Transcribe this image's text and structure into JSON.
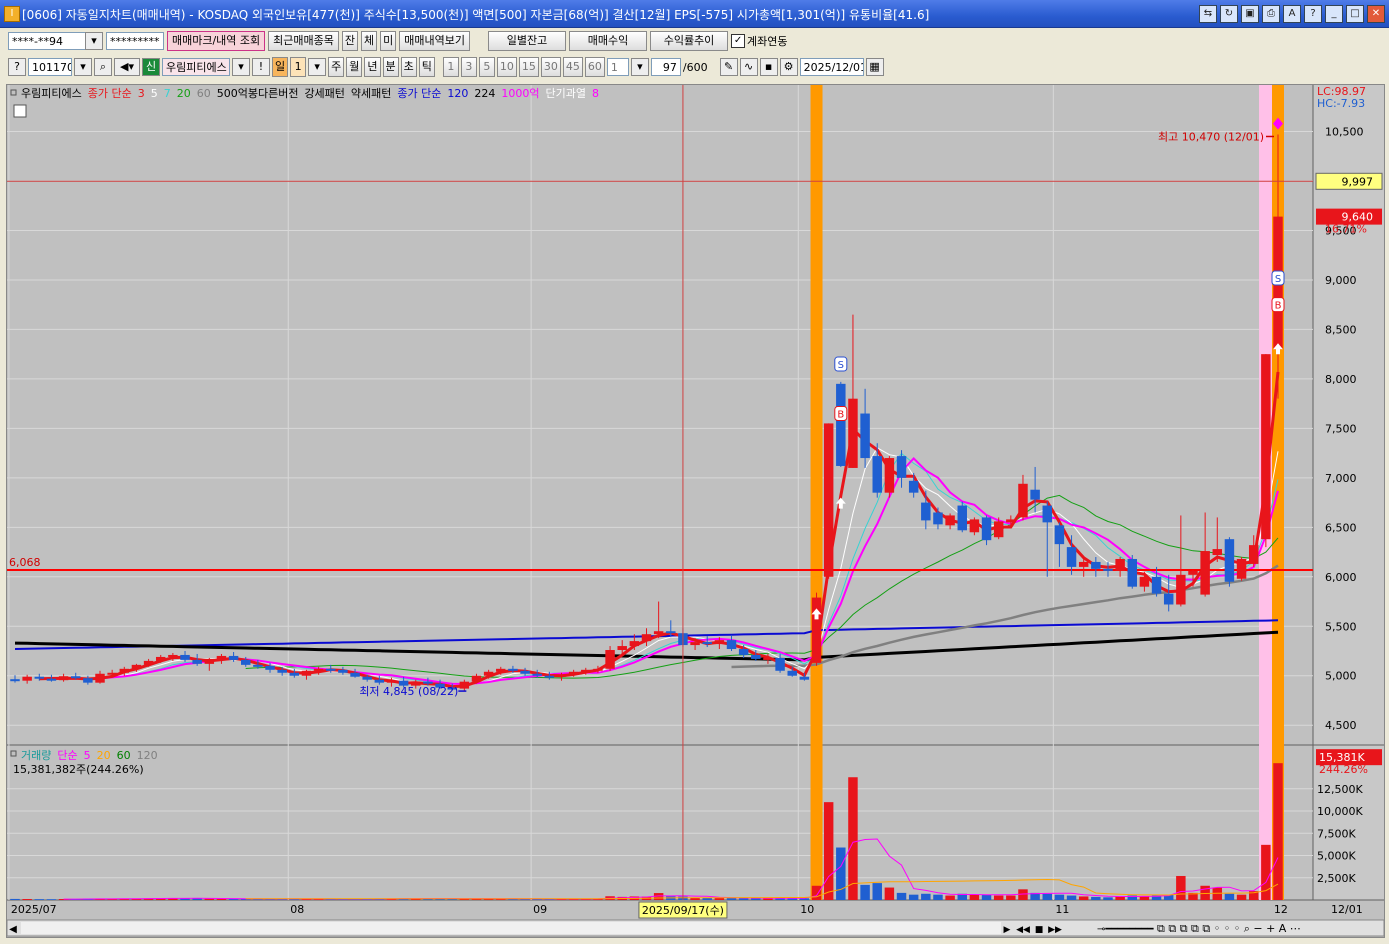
{
  "window": {
    "title": "[0606] 자동일지차트(매매내역) - KOSDAQ 외국인보유[477(천)] 주식수[13,500(천)] 액면[500] 자본금[68(억)] 결산[12월] EPS[-575] 시가총액[1,301(억)] 유통비율[41.6]",
    "icon": "I"
  },
  "toolbar1": {
    "account": "****-**94",
    "password": "*********",
    "buttons": [
      "매매마크/내역 조회",
      "최근매매종목",
      "잔",
      "체",
      "미",
      "매매내역보기"
    ],
    "buttons2": [
      "일별잔고",
      "매매수익",
      "수익률추이"
    ],
    "checkbox_label": "계좌연동",
    "checked": true
  },
  "toolbar2": {
    "code": "101170",
    "shin": "신",
    "stock_name": "우림피티에스",
    "period_selected": "일",
    "period_num": "1",
    "periods": [
      "주",
      "월",
      "년",
      "분",
      "초",
      "틱"
    ],
    "intervals": [
      "1",
      "3",
      "5",
      "10",
      "15",
      "30",
      "45",
      "60"
    ],
    "count_sel": "1",
    "count": "97",
    "count_max": "/600",
    "date": "2025/12/01"
  },
  "legend": {
    "main": [
      {
        "t": "우림피티에스",
        "c": "#000000"
      },
      {
        "t": "종가 단순",
        "c": "#e8151b"
      },
      {
        "t": "3",
        "c": "#e8151b"
      },
      {
        "t": "5",
        "c": "#ffffff"
      },
      {
        "t": "7",
        "c": "#37d3d3"
      },
      {
        "t": "20",
        "c": "#14a014"
      },
      {
        "t": "60",
        "c": "#808080"
      },
      {
        "t": "500억봉다른버전",
        "c": "#000000"
      },
      {
        "t": "강세패턴",
        "c": "#000000"
      },
      {
        "t": "약세패턴",
        "c": "#000000"
      },
      {
        "t": "종가 단순",
        "c": "#0a0ad2"
      },
      {
        "t": "120",
        "c": "#0a0ad2"
      },
      {
        "t": "224",
        "c": "#000000"
      },
      {
        "t": "1000억",
        "c": "#ff00ff"
      },
      {
        "t": "단기과열",
        "c": "#ffffff"
      },
      {
        "t": "8",
        "c": "#ff00ff"
      }
    ],
    "volume": [
      {
        "t": "거래량",
        "c": "#189a9a"
      },
      {
        "t": "단순",
        "c": "#ff00ff"
      },
      {
        "t": "5",
        "c": "#ff00ff"
      },
      {
        "t": "20",
        "c": "#ffa500"
      },
      {
        "t": "60",
        "c": "#008000"
      },
      {
        "t": "120",
        "c": "#808080"
      }
    ],
    "volume_value": "15,381,382주(244.26%)"
  },
  "chart_data": {
    "type": "candlestick",
    "price_axis": {
      "ticks": [
        "10,500",
        "10,000",
        "9,500",
        "9,000",
        "8,500",
        "8,000",
        "7,500",
        "7,000",
        "6,500",
        "6,000",
        "5,500",
        "5,000",
        "4,500"
      ],
      "ylim": [
        4300,
        10950
      ]
    },
    "volume_axis": {
      "ticks": [
        "12,500K",
        "10,000K",
        "7,500K",
        "5,000K",
        "2,500K"
      ],
      "ylim": [
        0,
        16300
      ]
    },
    "lc": "LC:98.97",
    "hc": "HC:-7.93",
    "current_price": "9,640",
    "change_pct": "16.71%",
    "crosshair_price": "9,997",
    "level_line": 6068,
    "level_label": "6,068",
    "volume_current": "15,381K",
    "volume_pct": "244.26%",
    "high_note": "최고 10,470 (12/01)",
    "low_note": "최저 4,845 (08/22)",
    "x_labels": [
      "2025/07",
      "08",
      "09",
      "10",
      "11",
      "12",
      "12/01"
    ],
    "crosshair_date": "2025/09/17(수)",
    "highlight_days": [
      {
        "date": "10/02",
        "color": "orange"
      },
      {
        "date": "12/01",
        "color": "orange"
      }
    ],
    "signals": [
      {
        "date": "10/06",
        "type": "S"
      },
      {
        "date": "10/06",
        "type": "B"
      },
      {
        "date": "12/01",
        "type": "S"
      },
      {
        "date": "12/01",
        "type": "B"
      }
    ],
    "candles": [
      {
        "d": "07/01",
        "o": 4965,
        "h": 5005,
        "l": 4930,
        "c": 4950,
        "v": 120
      },
      {
        "d": "07/02",
        "o": 4950,
        "h": 5010,
        "l": 4920,
        "c": 4990,
        "v": 110
      },
      {
        "d": "07/03",
        "o": 4990,
        "h": 5020,
        "l": 4950,
        "c": 4970,
        "v": 95
      },
      {
        "d": "07/04",
        "o": 4970,
        "h": 5010,
        "l": 4940,
        "c": 4955,
        "v": 90
      },
      {
        "d": "07/07",
        "o": 4955,
        "h": 5020,
        "l": 4940,
        "c": 4995,
        "v": 110
      },
      {
        "d": "07/08",
        "o": 4995,
        "h": 5030,
        "l": 4960,
        "c": 4975,
        "v": 100
      },
      {
        "d": "07/09",
        "o": 4975,
        "h": 5000,
        "l": 4910,
        "c": 4930,
        "v": 140
      },
      {
        "d": "07/10",
        "o": 4930,
        "h": 5050,
        "l": 4920,
        "c": 5020,
        "v": 160
      },
      {
        "d": "07/11",
        "o": 5020,
        "h": 5060,
        "l": 4990,
        "c": 5030,
        "v": 130
      },
      {
        "d": "07/14",
        "o": 5030,
        "h": 5090,
        "l": 5000,
        "c": 5070,
        "v": 150
      },
      {
        "d": "07/15",
        "o": 5070,
        "h": 5120,
        "l": 5040,
        "c": 5110,
        "v": 170
      },
      {
        "d": "07/16",
        "o": 5110,
        "h": 5170,
        "l": 5090,
        "c": 5150,
        "v": 190
      },
      {
        "d": "07/17",
        "o": 5150,
        "h": 5210,
        "l": 5130,
        "c": 5190,
        "v": 200
      },
      {
        "d": "07/18",
        "o": 5190,
        "h": 5230,
        "l": 5150,
        "c": 5210,
        "v": 170
      },
      {
        "d": "07/21",
        "o": 5210,
        "h": 5250,
        "l": 5140,
        "c": 5160,
        "v": 180
      },
      {
        "d": "07/22",
        "o": 5160,
        "h": 5220,
        "l": 5100,
        "c": 5120,
        "v": 190
      },
      {
        "d": "07/23",
        "o": 5120,
        "h": 5180,
        "l": 5050,
        "c": 5170,
        "v": 150
      },
      {
        "d": "07/24",
        "o": 5170,
        "h": 5220,
        "l": 5120,
        "c": 5200,
        "v": 140
      },
      {
        "d": "07/25",
        "o": 5200,
        "h": 5240,
        "l": 5140,
        "c": 5160,
        "v": 130
      },
      {
        "d": "07/28",
        "o": 5160,
        "h": 5190,
        "l": 5090,
        "c": 5110,
        "v": 120
      },
      {
        "d": "07/29",
        "o": 5110,
        "h": 5160,
        "l": 5070,
        "c": 5100,
        "v": 110
      },
      {
        "d": "07/30",
        "o": 5100,
        "h": 5130,
        "l": 5030,
        "c": 5060,
        "v": 130
      },
      {
        "d": "07/31",
        "o": 5060,
        "h": 5090,
        "l": 5000,
        "c": 5030,
        "v": 150
      },
      {
        "d": "08/01",
        "o": 5030,
        "h": 5070,
        "l": 4980,
        "c": 5000,
        "v": 140
      },
      {
        "d": "08/04",
        "o": 5000,
        "h": 5060,
        "l": 4960,
        "c": 5050,
        "v": 120
      },
      {
        "d": "08/05",
        "o": 5050,
        "h": 5090,
        "l": 5010,
        "c": 5070,
        "v": 110
      },
      {
        "d": "08/06",
        "o": 5070,
        "h": 5110,
        "l": 5030,
        "c": 5060,
        "v": 100
      },
      {
        "d": "08/07",
        "o": 5060,
        "h": 5090,
        "l": 5010,
        "c": 5030,
        "v": 110
      },
      {
        "d": "08/08",
        "o": 5030,
        "h": 5070,
        "l": 4980,
        "c": 4990,
        "v": 130
      },
      {
        "d": "08/11",
        "o": 4990,
        "h": 5010,
        "l": 4940,
        "c": 4960,
        "v": 140
      },
      {
        "d": "08/12",
        "o": 4960,
        "h": 5000,
        "l": 4910,
        "c": 4930,
        "v": 160
      },
      {
        "d": "08/13",
        "o": 4930,
        "h": 4980,
        "l": 4890,
        "c": 4950,
        "v": 170
      },
      {
        "d": "08/14",
        "o": 4950,
        "h": 4990,
        "l": 4880,
        "c": 4900,
        "v": 180
      },
      {
        "d": "08/18",
        "o": 4900,
        "h": 4960,
        "l": 4870,
        "c": 4940,
        "v": 170
      },
      {
        "d": "08/19",
        "o": 4940,
        "h": 4980,
        "l": 4900,
        "c": 4920,
        "v": 150
      },
      {
        "d": "08/20",
        "o": 4920,
        "h": 4960,
        "l": 4870,
        "c": 4880,
        "v": 160
      },
      {
        "d": "08/21",
        "o": 4880,
        "h": 4920,
        "l": 4850,
        "c": 4870,
        "v": 170
      },
      {
        "d": "08/22",
        "o": 4870,
        "h": 4960,
        "l": 4845,
        "c": 4940,
        "v": 190
      },
      {
        "d": "08/25",
        "o": 4940,
        "h": 5020,
        "l": 4920,
        "c": 5000,
        "v": 160
      },
      {
        "d": "08/26",
        "o": 5000,
        "h": 5060,
        "l": 4970,
        "c": 5040,
        "v": 150
      },
      {
        "d": "08/27",
        "o": 5040,
        "h": 5090,
        "l": 5010,
        "c": 5070,
        "v": 140
      },
      {
        "d": "08/28",
        "o": 5070,
        "h": 5100,
        "l": 5030,
        "c": 5050,
        "v": 130
      },
      {
        "d": "08/29",
        "o": 5050,
        "h": 5080,
        "l": 5000,
        "c": 5020,
        "v": 120
      },
      {
        "d": "09/01",
        "o": 5020,
        "h": 5060,
        "l": 4980,
        "c": 5000,
        "v": 120
      },
      {
        "d": "09/02",
        "o": 5000,
        "h": 5040,
        "l": 4960,
        "c": 4990,
        "v": 110
      },
      {
        "d": "09/03",
        "o": 4990,
        "h": 5030,
        "l": 4950,
        "c": 5010,
        "v": 120
      },
      {
        "d": "09/04",
        "o": 5010,
        "h": 5060,
        "l": 4990,
        "c": 5040,
        "v": 130
      },
      {
        "d": "09/05",
        "o": 5040,
        "h": 5080,
        "l": 5010,
        "c": 5060,
        "v": 140
      },
      {
        "d": "09/08",
        "o": 5060,
        "h": 5100,
        "l": 5030,
        "c": 5070,
        "v": 160
      },
      {
        "d": "09/09",
        "o": 5070,
        "h": 5300,
        "l": 5050,
        "c": 5260,
        "v": 420
      },
      {
        "d": "09/10",
        "o": 5260,
        "h": 5360,
        "l": 5200,
        "c": 5300,
        "v": 350
      },
      {
        "d": "09/11",
        "o": 5300,
        "h": 5420,
        "l": 5260,
        "c": 5350,
        "v": 400
      },
      {
        "d": "09/12",
        "o": 5350,
        "h": 5480,
        "l": 5300,
        "c": 5420,
        "v": 380
      },
      {
        "d": "09/15",
        "o": 5420,
        "h": 5750,
        "l": 5380,
        "c": 5450,
        "v": 780
      },
      {
        "d": "09/16",
        "o": 5450,
        "h": 5560,
        "l": 5390,
        "c": 5430,
        "v": 420
      },
      {
        "d": "09/17",
        "o": 5430,
        "h": 5480,
        "l": 5290,
        "c": 5310,
        "v": 380
      },
      {
        "d": "09/18",
        "o": 5310,
        "h": 5380,
        "l": 5260,
        "c": 5340,
        "v": 260
      },
      {
        "d": "09/19",
        "o": 5340,
        "h": 5400,
        "l": 5290,
        "c": 5320,
        "v": 240
      },
      {
        "d": "09/22",
        "o": 5320,
        "h": 5390,
        "l": 5270,
        "c": 5360,
        "v": 230
      },
      {
        "d": "09/23",
        "o": 5360,
        "h": 5410,
        "l": 5250,
        "c": 5270,
        "v": 220
      },
      {
        "d": "09/24",
        "o": 5270,
        "h": 5310,
        "l": 5180,
        "c": 5210,
        "v": 200
      },
      {
        "d": "09/25",
        "o": 5210,
        "h": 5260,
        "l": 5150,
        "c": 5170,
        "v": 180
      },
      {
        "d": "09/26",
        "o": 5170,
        "h": 5220,
        "l": 5120,
        "c": 5180,
        "v": 170
      },
      {
        "d": "09/29",
        "o": 5180,
        "h": 5220,
        "l": 5030,
        "c": 5050,
        "v": 230
      },
      {
        "d": "09/30",
        "o": 5050,
        "h": 5090,
        "l": 4990,
        "c": 5000,
        "v": 200
      },
      {
        "d": "10/01",
        "o": 4990,
        "h": 5030,
        "l": 4950,
        "c": 4960,
        "v": 190
      },
      {
        "d": "10/02",
        "o": 5130,
        "h": 5840,
        "l": 5100,
        "c": 5790,
        "v": 1600
      },
      {
        "d": "10/06",
        "o": 6000,
        "h": 7550,
        "l": 5980,
        "c": 7550,
        "v": 11000
      },
      {
        "d": "10/07",
        "o": 7950,
        "h": 7970,
        "l": 7110,
        "c": 7120,
        "v": 5900
      },
      {
        "d": "10/08",
        "o": 7100,
        "h": 8650,
        "l": 7100,
        "c": 7800,
        "v": 13800
      },
      {
        "d": "10/10",
        "o": 7650,
        "h": 7900,
        "l": 7100,
        "c": 7200,
        "v": 1700
      },
      {
        "d": "10/13",
        "o": 7220,
        "h": 7350,
        "l": 6800,
        "c": 6850,
        "v": 1900
      },
      {
        "d": "10/14",
        "o": 6850,
        "h": 7220,
        "l": 6800,
        "c": 7200,
        "v": 1400
      },
      {
        "d": "10/15",
        "o": 7220,
        "h": 7280,
        "l": 6900,
        "c": 7000,
        "v": 800
      },
      {
        "d": "10/16",
        "o": 6970,
        "h": 7050,
        "l": 6800,
        "c": 6850,
        "v": 600
      },
      {
        "d": "10/17",
        "o": 6750,
        "h": 6870,
        "l": 6480,
        "c": 6570,
        "v": 700
      },
      {
        "d": "10/20",
        "o": 6650,
        "h": 6700,
        "l": 6480,
        "c": 6530,
        "v": 600
      },
      {
        "d": "10/21",
        "o": 6520,
        "h": 6640,
        "l": 6480,
        "c": 6620,
        "v": 500
      },
      {
        "d": "10/22",
        "o": 6720,
        "h": 6760,
        "l": 6450,
        "c": 6470,
        "v": 700
      },
      {
        "d": "10/23",
        "o": 6450,
        "h": 6600,
        "l": 6420,
        "c": 6580,
        "v": 600
      },
      {
        "d": "10/24",
        "o": 6600,
        "h": 6620,
        "l": 6320,
        "c": 6370,
        "v": 600
      },
      {
        "d": "10/27",
        "o": 6400,
        "h": 6600,
        "l": 6380,
        "c": 6560,
        "v": 500
      },
      {
        "d": "10/28",
        "o": 6550,
        "h": 6620,
        "l": 6500,
        "c": 6580,
        "v": 500
      },
      {
        "d": "10/29",
        "o": 6600,
        "h": 7030,
        "l": 6570,
        "c": 6940,
        "v": 1200
      },
      {
        "d": "10/30",
        "o": 6880,
        "h": 7110,
        "l": 6650,
        "c": 6780,
        "v": 800
      },
      {
        "d": "10/31",
        "o": 6720,
        "h": 6760,
        "l": 6000,
        "c": 6550,
        "v": 700
      },
      {
        "d": "11/03",
        "o": 6520,
        "h": 6550,
        "l": 6100,
        "c": 6330,
        "v": 600
      },
      {
        "d": "11/04",
        "o": 6300,
        "h": 6420,
        "l": 6020,
        "c": 6100,
        "v": 500
      },
      {
        "d": "11/05",
        "o": 6100,
        "h": 6200,
        "l": 6000,
        "c": 6150,
        "v": 400
      },
      {
        "d": "11/06",
        "o": 6150,
        "h": 6200,
        "l": 6000,
        "c": 6080,
        "v": 350
      },
      {
        "d": "11/07",
        "o": 6080,
        "h": 6150,
        "l": 6000,
        "c": 6060,
        "v": 300
      },
      {
        "d": "11/10",
        "o": 6060,
        "h": 6200,
        "l": 6000,
        "c": 6180,
        "v": 400
      },
      {
        "d": "11/11",
        "o": 6180,
        "h": 6220,
        "l": 5880,
        "c": 5900,
        "v": 500
      },
      {
        "d": "11/12",
        "o": 5900,
        "h": 6050,
        "l": 5850,
        "c": 6000,
        "v": 450
      },
      {
        "d": "11/13",
        "o": 6000,
        "h": 6100,
        "l": 5800,
        "c": 5830,
        "v": 500
      },
      {
        "d": "11/14",
        "o": 5830,
        "h": 6020,
        "l": 5650,
        "c": 5720,
        "v": 600
      },
      {
        "d": "11/17",
        "o": 5720,
        "h": 6620,
        "l": 5700,
        "c": 6020,
        "v": 2700
      },
      {
        "d": "11/18",
        "o": 6020,
        "h": 6070,
        "l": 5900,
        "c": 6060,
        "v": 800
      },
      {
        "d": "11/19",
        "o": 5820,
        "h": 6650,
        "l": 5800,
        "c": 6260,
        "v": 1600
      },
      {
        "d": "11/20",
        "o": 6220,
        "h": 6600,
        "l": 6150,
        "c": 6280,
        "v": 1400
      },
      {
        "d": "11/21",
        "o": 6380,
        "h": 6400,
        "l": 5900,
        "c": 5950,
        "v": 700
      },
      {
        "d": "11/24",
        "o": 5980,
        "h": 6200,
        "l": 5960,
        "c": 6180,
        "v": 600
      },
      {
        "d": "11/25",
        "o": 6130,
        "h": 6420,
        "l": 6100,
        "c": 6320,
        "v": 1000
      },
      {
        "d": "11/26",
        "o": 6380,
        "h": 8250,
        "l": 6300,
        "c": 8250,
        "v": 6200
      },
      {
        "d": "12/01",
        "o": 8300,
        "h": 10470,
        "l": 7800,
        "c": 9640,
        "v": 15381
      }
    ],
    "ma_colors": {
      "ma3": "#e8151b",
      "ma5": "#ffffff",
      "ma7": "#37d3d3",
      "ma20": "#14a014",
      "ma60": "#808080",
      "ma120": "#0a0ad2",
      "ma224": "#000000",
      "ma1000": "#ff00ff",
      "vma5": "#ff00ff",
      "vma20": "#ffa500",
      "vma60": "#008000"
    }
  },
  "bottom": {
    "nav_icons": [
      "arrow-right-icon",
      "rewind-icon",
      "stop-icon",
      "fast-forward-icon"
    ]
  }
}
